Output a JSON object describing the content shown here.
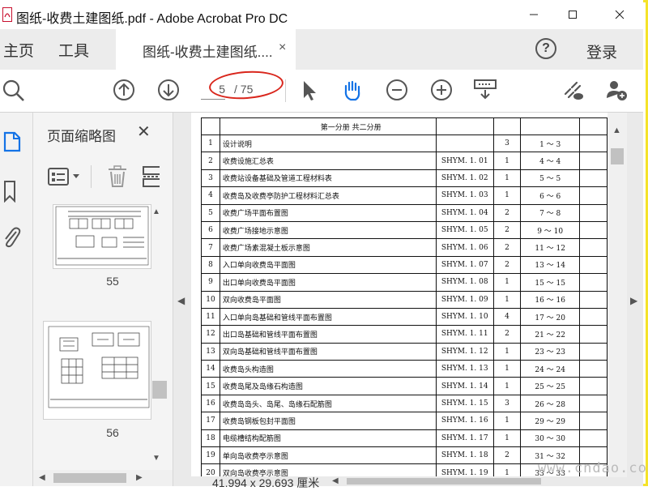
{
  "window": {
    "title": "图纸-收费土建图纸.pdf - Adobe Acrobat Pro DC",
    "minimize": "─",
    "maximize": "☐",
    "close": "✕"
  },
  "menu": {
    "home": "主页",
    "tools": "工具",
    "tab_label": "图纸-收费土建图纸....",
    "tab_close": "×",
    "help": "?",
    "login": "登录"
  },
  "toolbar": {
    "page_current": "5",
    "page_total": "/ 75",
    "icons": [
      "search-icon",
      "page-up-icon",
      "page-down-icon",
      "select-cursor-icon",
      "hand-tool-icon",
      "zoom-out-icon",
      "zoom-in-icon",
      "scroll-mode-icon",
      "share-link-icon",
      "add-user-icon"
    ]
  },
  "thumbnail_pane": {
    "title": "页面缩略图",
    "close": "✕",
    "thumbnails": [
      {
        "label": "55"
      },
      {
        "label": "56"
      }
    ]
  },
  "document": {
    "header": "第一分册   共二分册",
    "rows": [
      {
        "no": "1",
        "name": "设计说明",
        "code": "",
        "sheets": "3",
        "pages": "1 ～ 3"
      },
      {
        "no": "2",
        "name": "收费设施汇总表",
        "code": "SHYM. 1. 01",
        "sheets": "1",
        "pages": "4 ～ 4"
      },
      {
        "no": "3",
        "name": "收费站设备基础及管道工程材料表",
        "code": "SHYM. 1. 02",
        "sheets": "1",
        "pages": "5 ～ 5"
      },
      {
        "no": "4",
        "name": "收费岛及收费亭防护工程材料汇总表",
        "code": "SHYM. 1. 03",
        "sheets": "1",
        "pages": "6 ～ 6"
      },
      {
        "no": "5",
        "name": "收费广场平面布置图",
        "code": "SHYM. 1. 04",
        "sheets": "2",
        "pages": "7 ～ 8"
      },
      {
        "no": "6",
        "name": "收费广场接地示意图",
        "code": "SHYM. 1. 05",
        "sheets": "2",
        "pages": "9 ～ 10"
      },
      {
        "no": "7",
        "name": "收费广场素混凝土板示意图",
        "code": "SHYM. 1. 06",
        "sheets": "2",
        "pages": "11 ～ 12"
      },
      {
        "no": "8",
        "name": "入口单向收费岛平面图",
        "code": "SHYM. 1. 07",
        "sheets": "2",
        "pages": "13 ～ 14"
      },
      {
        "no": "9",
        "name": "出口单向收费岛平面图",
        "code": "SHYM. 1. 08",
        "sheets": "1",
        "pages": "15 ～ 15"
      },
      {
        "no": "10",
        "name": "双向收费岛平面图",
        "code": "SHYM. 1. 09",
        "sheets": "1",
        "pages": "16 ～ 16"
      },
      {
        "no": "11",
        "name": "入口单向岛基础和管线平面布置图",
        "code": "SHYM. 1. 10",
        "sheets": "4",
        "pages": "17 ～ 20"
      },
      {
        "no": "12",
        "name": "出口岛基础和管线平面布置图",
        "code": "SHYM. 1. 11",
        "sheets": "2",
        "pages": "21 ～ 22"
      },
      {
        "no": "13",
        "name": "双向岛基础和管线平面布置图",
        "code": "SHYM. 1. 12",
        "sheets": "1",
        "pages": "23 ～ 23"
      },
      {
        "no": "14",
        "name": "收费岛头构造图",
        "code": "SHYM. 1. 13",
        "sheets": "1",
        "pages": "24 ～ 24"
      },
      {
        "no": "15",
        "name": "收费岛尾及岛缘石构造图",
        "code": "SHYM. 1. 14",
        "sheets": "1",
        "pages": "25 ～ 25"
      },
      {
        "no": "16",
        "name": "收费岛岛头、岛尾、岛缘石配筋图",
        "code": "SHYM. 1. 15",
        "sheets": "3",
        "pages": "26 ～ 28"
      },
      {
        "no": "17",
        "name": "收费岛钢板包封平面图",
        "code": "SHYM. 1. 16",
        "sheets": "1",
        "pages": "29 ～ 29"
      },
      {
        "no": "18",
        "name": "电缆槽结构配筋图",
        "code": "SHYM. 1. 17",
        "sheets": "1",
        "pages": "30 ～ 30"
      },
      {
        "no": "19",
        "name": "单向岛收费亭示意图",
        "code": "SHYM. 1. 18",
        "sheets": "2",
        "pages": "31 ～ 32"
      },
      {
        "no": "20",
        "name": "双向岛收费亭示意图",
        "code": "SHYM. 1. 19",
        "sheets": "1",
        "pages": "33 ～ 33"
      }
    ]
  },
  "statusbar": {
    "page_size": "41.994 x 29.693 厘米"
  },
  "watermark": "www.cndao.com",
  "colors": {
    "frame": "#f5e32a",
    "annotation": "#d9261c",
    "hand_tool": "#1473e6"
  }
}
